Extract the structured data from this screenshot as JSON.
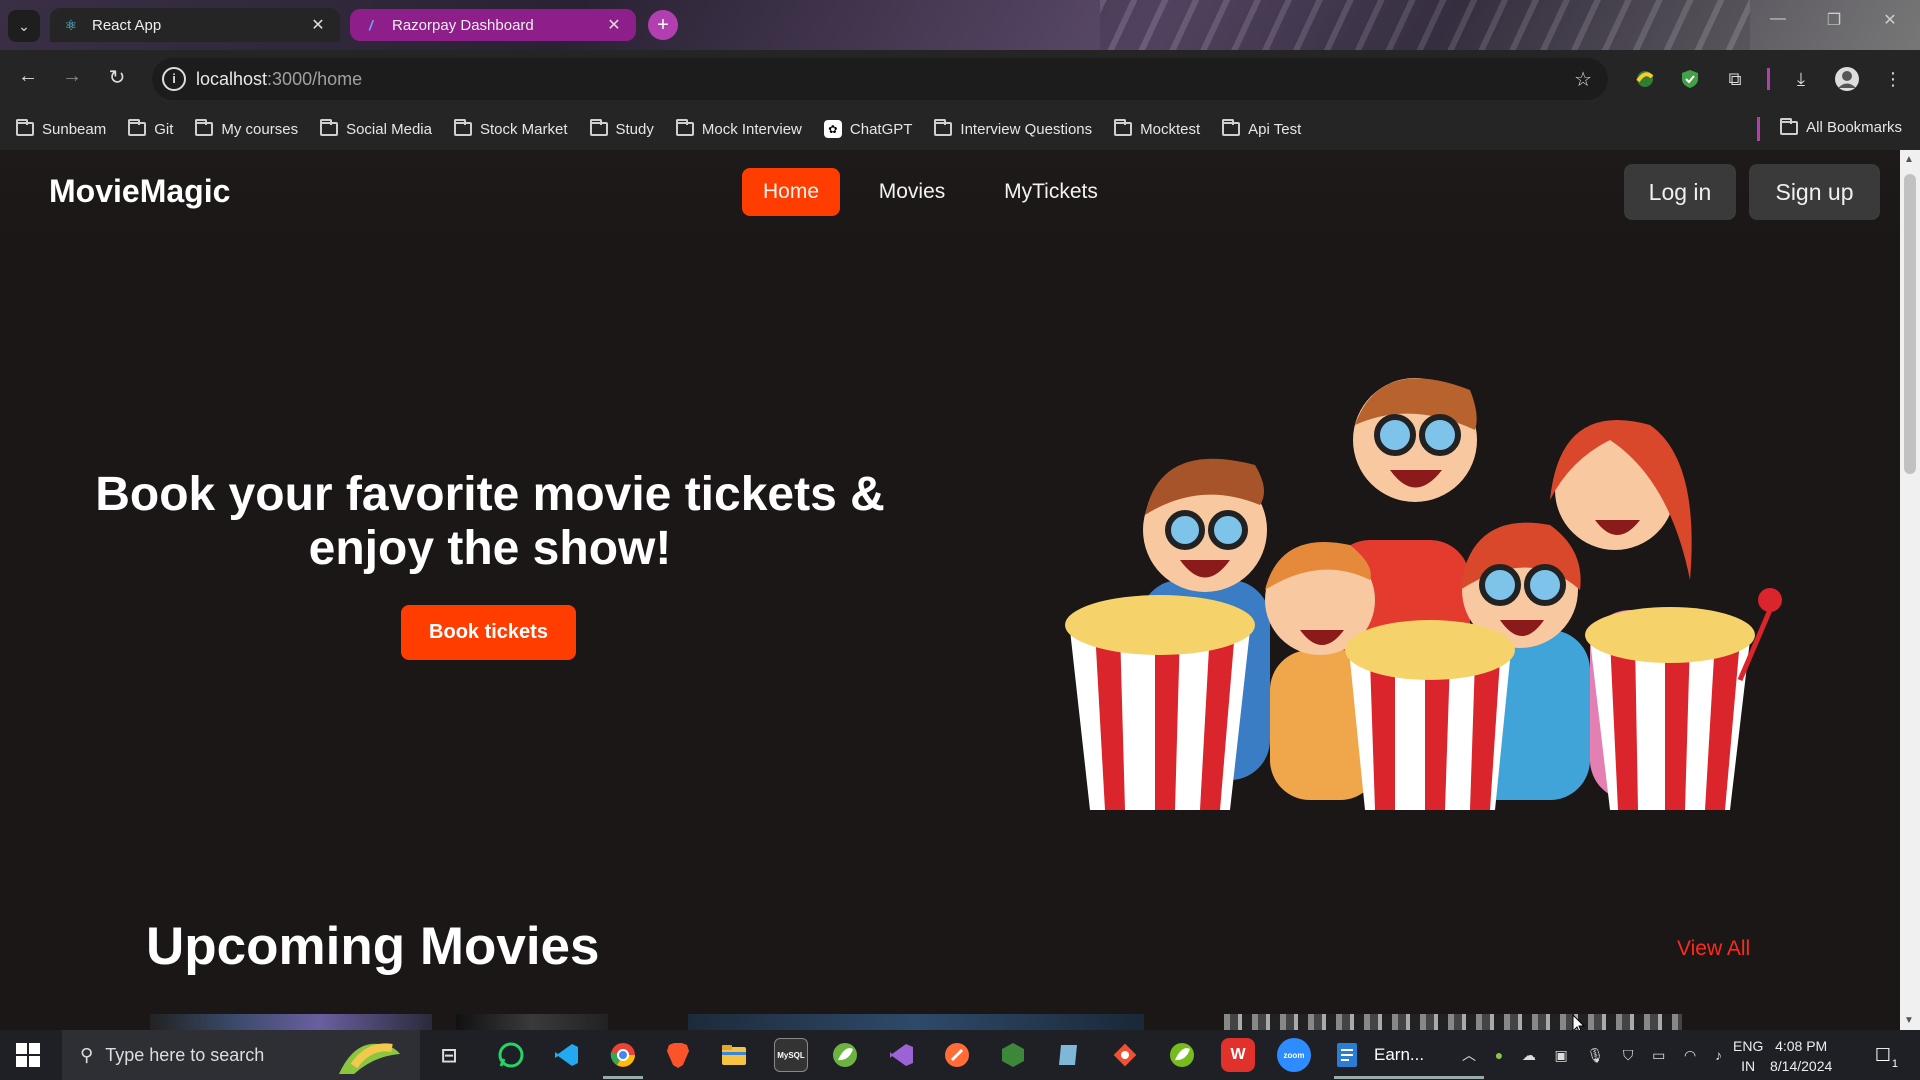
{
  "browser": {
    "tabs": [
      {
        "title": "React App",
        "active": true
      },
      {
        "title": "Razorpay Dashboard",
        "active": false
      }
    ],
    "url_host": "localhost",
    "url_path": ":3000/home",
    "bookmarks": [
      "Sunbeam",
      "Git",
      "My courses",
      "Social Media",
      "Stock Market",
      "Study",
      "Mock Interview",
      "ChatGPT",
      "Interview Questions",
      "Mocktest",
      "Api Test"
    ],
    "all_bookmarks": "All Bookmarks",
    "colors": {
      "tab_group": "#8e1f8a",
      "new_tab": "#b23fb0"
    }
  },
  "site": {
    "brand": "MovieMagic",
    "nav": [
      "Home",
      "Movies",
      "MyTickets"
    ],
    "active_nav": "Home",
    "login": "Log in",
    "signup": "Sign up",
    "accent": "#ff3d00"
  },
  "hero": {
    "title": "Book your favorite movie tickets & enjoy the show!",
    "cta": "Book tickets"
  },
  "upcoming": {
    "title": "Upcoming Movies",
    "view_all": "View All"
  },
  "taskbar": {
    "search_placeholder": "Type here to search",
    "active_doc_label": "Earn...",
    "lang_line1": "ENG",
    "lang_line2": "IN",
    "time": "4:08 PM",
    "date": "8/14/2024",
    "notifications": "1"
  }
}
